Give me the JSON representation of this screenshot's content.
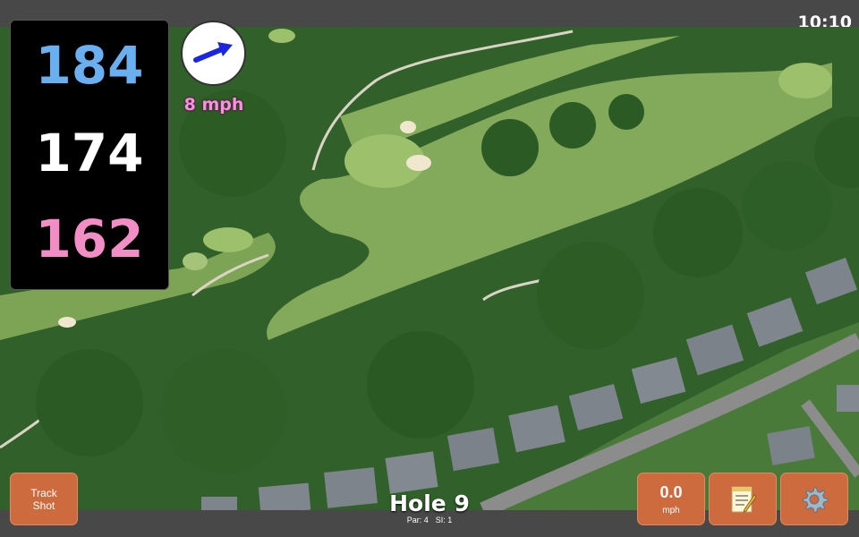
{
  "status_bar": {
    "time": "10:10"
  },
  "distances": {
    "back": "184",
    "middle": "174",
    "front": "162"
  },
  "wind": {
    "speed": "8 mph",
    "direction_icon": "arrow-icon"
  },
  "buttons": {
    "track_shot_line1": "Track",
    "track_shot_line2": "Shot",
    "speed_value": "0.0",
    "speed_unit": "mph",
    "notes_icon": "notepad-icon",
    "settings_icon": "gear-icon"
  },
  "hole": {
    "title": "Hole 9",
    "par": "Par: 4",
    "si": "SI: 1"
  },
  "colors": {
    "accent_button": "#cd6b3e",
    "back_distance": "#6ab0f0",
    "middle_distance": "#ffffff",
    "front_distance": "#f28ec5",
    "wind_text": "#ff8fe0"
  }
}
